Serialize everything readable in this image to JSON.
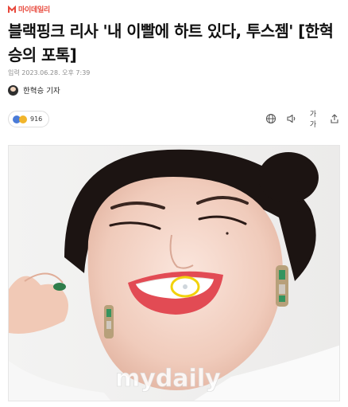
{
  "brand": {
    "name": "마이데일리",
    "logo_icon": "mydaily-logo-icon",
    "accent": "#e8483b"
  },
  "article": {
    "headline": "블랙핑크 리사 '내 이빨에 하트 있다, 투스젬' [한혁승의 포톡]",
    "meta": "입력 2023.06.28. 오후 7:39",
    "reporter": "한혁승 기자"
  },
  "reactions": {
    "count": "916",
    "icons": [
      "surprised-emoji-icon",
      "laugh-emoji-icon"
    ]
  },
  "toolbar": {
    "subscribe_icon": "globe-icon",
    "listen_icon": "speaker-icon",
    "font_label": "가가",
    "share_icon": "share-icon"
  },
  "photo": {
    "watermark": "mydaily"
  }
}
